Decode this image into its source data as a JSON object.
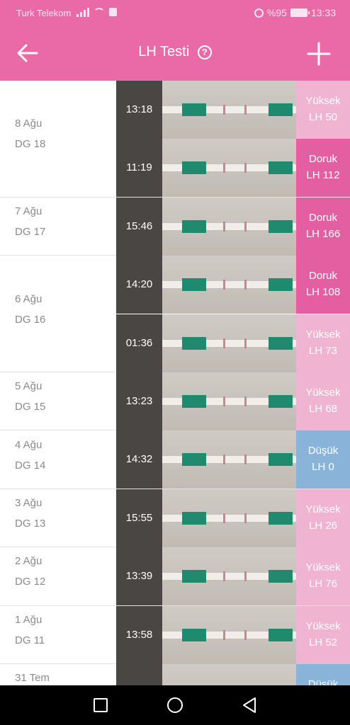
{
  "status_bar": {
    "carrier": "Turk Telekom",
    "battery": "%95",
    "time": "13:33"
  },
  "header": {
    "title": "LH Testi",
    "help_symbol": "?",
    "back_icon": "arrow-left-icon",
    "add_icon": "plus-icon",
    "color": "#e96aa6"
  },
  "colors": {
    "yuksek": "#f0b3d1",
    "doruk": "#e45fa1",
    "dusuk": "#8ab3da"
  },
  "days": [
    {
      "date": "8 Ağu",
      "dg": "DG 18",
      "tests": [
        {
          "time": "13:18",
          "level": "Yüksek",
          "value": "LH 50"
        },
        {
          "time": "11:19",
          "level": "Doruk",
          "value": "LH 112"
        }
      ]
    },
    {
      "date": "7 Ağu",
      "dg": "DG 17",
      "tests": [
        {
          "time": "15:46",
          "level": "Doruk",
          "value": "LH 166"
        }
      ]
    },
    {
      "date": "6 Ağu",
      "dg": "DG 16",
      "tests": [
        {
          "time": "14:20",
          "level": "Doruk",
          "value": "LH 108"
        },
        {
          "time": "01:36",
          "level": "Yüksek",
          "value": "LH 73"
        }
      ]
    },
    {
      "date": "5 Ağu",
      "dg": "DG 15",
      "tests": [
        {
          "time": "13:23",
          "level": "Yüksek",
          "value": "LH 68"
        }
      ]
    },
    {
      "date": "4 Ağu",
      "dg": "DG 14",
      "tests": [
        {
          "time": "14:32",
          "level": "Düşük",
          "value": "LH 0"
        }
      ]
    },
    {
      "date": "3 Ağu",
      "dg": "DG 13",
      "tests": [
        {
          "time": "15:55",
          "level": "Yüksek",
          "value": "LH 26"
        }
      ]
    },
    {
      "date": "2 Ağu",
      "dg": "DG 12",
      "tests": [
        {
          "time": "13:39",
          "level": "Yüksek",
          "value": "LH 76"
        }
      ]
    },
    {
      "date": "1 Ağu",
      "dg": "DG 11",
      "tests": [
        {
          "time": "13:58",
          "level": "Yüksek",
          "value": "LH 52"
        }
      ]
    },
    {
      "date": "31 Tem",
      "dg": "",
      "tests": [
        {
          "time": "",
          "level": "Düşük",
          "value": ""
        }
      ]
    }
  ],
  "navbar": {
    "back": "nav-back-icon",
    "home": "nav-home-icon",
    "recents": "nav-recents-icon"
  }
}
